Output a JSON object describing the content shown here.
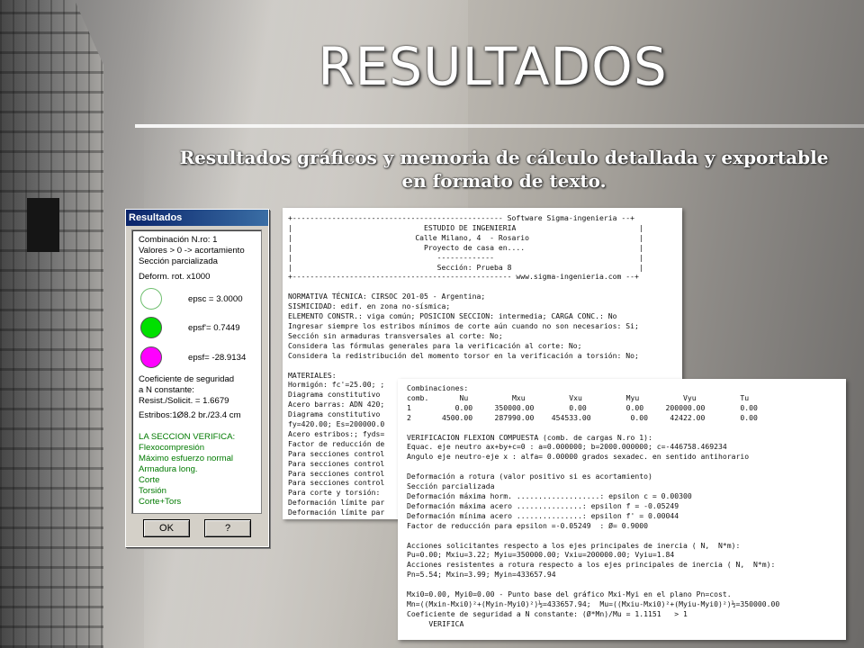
{
  "slide": {
    "title": "RESULTADOS",
    "subtitle": "Resultados gráficos y memoria de cálculo detallada y exportable en formato de texto."
  },
  "dialog": {
    "title": "Resultados",
    "combination": "Combinación N.ro: 1",
    "values_note": "Valores > 0 -> acortamiento",
    "section_state": "Sección parcializada",
    "deform_label": "Deform. rot. x1000",
    "epsc": "epsc =   3.0000",
    "epsf_prime": "epsf'=   0.7449",
    "epsf": "epsf= -28.9134",
    "coef_label1": "Coeficiente de seguridad",
    "coef_label2": "a N constante:",
    "coef_value": "Resist./Solicit. = 1.6679",
    "estribos": "Estribos:1Ø8.2 br./23.4 cm",
    "verifica_title": "LA SECCION VERIFICA:",
    "checks": [
      "Flexocompresión",
      "Máximo esfuerzo normal",
      "Armadura long.",
      "Corte",
      "Torsión",
      "Corte+Tors"
    ],
    "ok_label": "OK",
    "help_label": "?",
    "colors": {
      "empty_circle": "#ffffff",
      "circle2": "#00e000",
      "circle3": "#ff00ff",
      "green_text": "#007a00"
    }
  },
  "report1": {
    "lines": [
      "+------------------------------------------------ Software Sigma-ingenieria --+",
      "|                              ESTUDIO DE INGENIERIA                            |",
      "|                            Calle Milano, 4  - Rosario                         |",
      "|                              Proyecto de casa en....                          |",
      "|                                 -------------                                 |",
      "|                                 Sección: Prueba 8                             |",
      "+-------------------------------------------------- www.sigma-ingenieria.com --+",
      "",
      "NORMATIVA TÉCNICA: CIRSOC 201-05 - Argentina;",
      "SISMICIDAD: edif. en zona no-sísmica;",
      "ELEMENTO CONSTR.: viga común; POSICION SECCION: intermedia; CARGA CONC.: No",
      "Ingresar siempre los estribos mínimos de corte aún cuando no son necesarios: Si;",
      "Sección sin armaduras transversales al corte: No;",
      "Considera las fórmulas generales para la verificación al corte: No;",
      "Considera la redistribución del momento torsor en la verificación a torsión: No;",
      "",
      "MATERIALES:",
      "Hormigón: fc'=25.00; ;",
      "Diagrama constitutivo",
      "Acero barras: ADN 420;",
      "Diagrama constitutivo",
      "fy=420.00; Es=200000.0",
      "Acero estribos:; fyds=",
      "Factor de reducción de",
      "Para secciones control",
      "Para secciones control",
      "Para secciones control",
      "Para secciones control",
      "Para corte y torsión:",
      "Deformación límite par",
      "Deformación límite par"
    ]
  },
  "report2": {
    "lines": [
      "Combinaciones:",
      "comb.       Nu          Mxu          Vxu          Myu          Vyu          Tu",
      "1          0.00     350000.00        0.00         0.00     200000.00        0.00",
      "2       4500.00     287990.00    454533.00         0.00     42422.00        0.00",
      "",
      "VERIFICACION FLEXION COMPUESTA (comb. de cargas N.ro 1):",
      "Equac. eje neutro ax+by+c=0 : a=0.000000; b=2000.000000; c=-446758.469234",
      "Angulo eje neutro-eje x : alfa= 0.00000 grados sexadec. en sentido antihorario",
      "",
      "Deformación a rotura (valor positivo si es acortamiento)",
      "Sección parcializada",
      "Deformación máxima horm. ...................: epsilon c = 0.00300",
      "Deformación máxima acero ...............: epsilon f = -0.05249",
      "Deformación mínima acero ...............: epsilon f' = 0.00044",
      "Factor de reducción para epsilon =-0.05249  : Ø= 0.9000",
      "",
      "Acciones solicitantes respecto a los ejes principales de inercia ( N,  N*m):",
      "Pu=0.00; Mxiu=3.22; Myiu=350000.00; Vxiu=200000.00; Vyiu=1.84",
      "Acciones resistentes a rotura respecto a los ejes principales de inercia ( N,  N*m):",
      "Pn=5.54; Mxin=3.99; Myin=433657.94",
      "",
      "Mxi0=0.00, Myi0=0.00 - Punto base del gráfico Mxi-Myi en el plano Pn=cost.",
      "Mn=((Mxin-Mxi0)²+(Myin-Myi0)²)½=433657.94;  Mu=((Mxiu-Mxi0)²+(Myiu-Myi0)²)½=350000.00",
      "Coeficiente de seguridad a N constante: (Ø*Mn)/Mu = 1.1151   > 1",
      "     VERIFICA"
    ]
  }
}
